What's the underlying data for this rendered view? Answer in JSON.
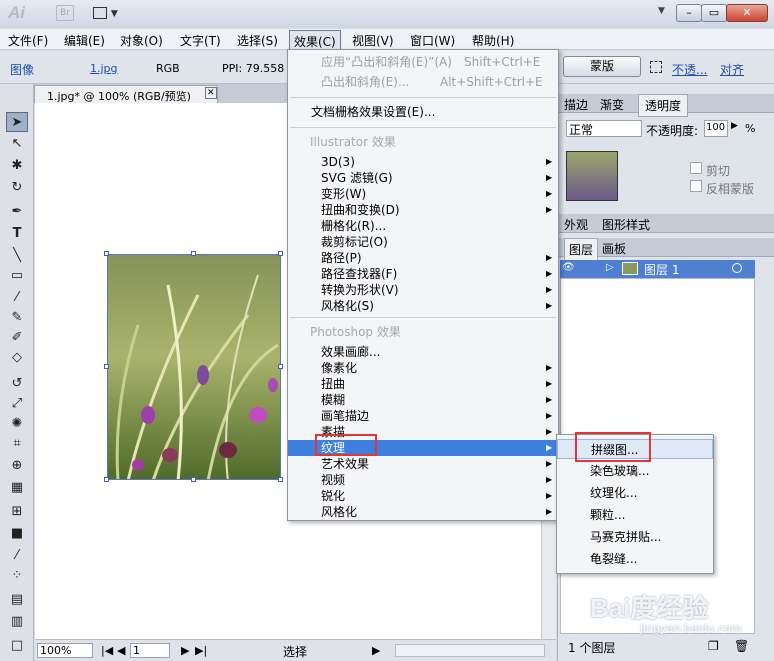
{
  "app": {
    "logo": "Ai",
    "bridge": "Br",
    "arrange_arrow": "▼"
  },
  "window_buttons": {
    "min": "–",
    "restore": "▭",
    "close": "✕"
  },
  "menubar": [
    "文件(F)",
    "编辑(E)",
    "对象(O)",
    "文字(T)",
    "选择(S)",
    "效果(C)",
    "视图(V)",
    "窗口(W)",
    "帮助(H)"
  ],
  "control_bar": {
    "type": "图像",
    "file": "1.jpg",
    "mode": "RGB",
    "ppi": "PPI: 79.558",
    "mask_button": "蒙版",
    "opacity_link": "不透...",
    "align_link": "对齐"
  },
  "doc_tab": {
    "title": "1.jpg* @ 100% (RGB/预览)",
    "close": "✕"
  },
  "effect_menu": {
    "apply": {
      "label": "应用“凸出和斜角(E)”(A)",
      "shortcut": "Shift+Ctrl+E"
    },
    "last": {
      "label": "凸出和斜角(E)...",
      "shortcut": "Alt+Shift+Ctrl+E"
    },
    "raster_settings": "文档栅格效果设置(E)...",
    "illustrator_header": "Illustrator 效果",
    "illustrator_items": [
      "3D(3)",
      "SVG 滤镜(G)",
      "变形(W)",
      "扭曲和变换(D)",
      "栅格化(R)...",
      "裁剪标记(O)",
      "路径(P)",
      "路径查找器(F)",
      "转换为形状(V)",
      "风格化(S)"
    ],
    "photoshop_header": "Photoshop 效果",
    "photoshop_items": [
      "效果画廊...",
      "像素化",
      "扭曲",
      "模糊",
      "画笔描边",
      "素描",
      "纹理",
      "艺术效果",
      "视频",
      "锐化",
      "风格化"
    ]
  },
  "texture_submenu": [
    "拼缀图...",
    "染色玻璃...",
    "纹理化...",
    "颗粒...",
    "马赛克拼贴...",
    "龟裂缝..."
  ],
  "panels": {
    "tabs1": [
      "描边",
      "渐变",
      "透明度"
    ],
    "blend_mode": "正常",
    "opacity_label": "不透明度:",
    "opacity_value": "100",
    "percent": "%",
    "clip": "剪切",
    "invert_mask": "反相蒙版",
    "tabs2": [
      "外观",
      "图形样式"
    ],
    "tabs3": [
      "图层",
      "画板"
    ],
    "layer_name": "图层 1",
    "layer_count": "1 个图层"
  },
  "status": {
    "zoom": "100%",
    "page": "1",
    "tool": "选择"
  },
  "watermark": {
    "brand": "Bai度经验",
    "url": "jingyan.baidu.com"
  }
}
